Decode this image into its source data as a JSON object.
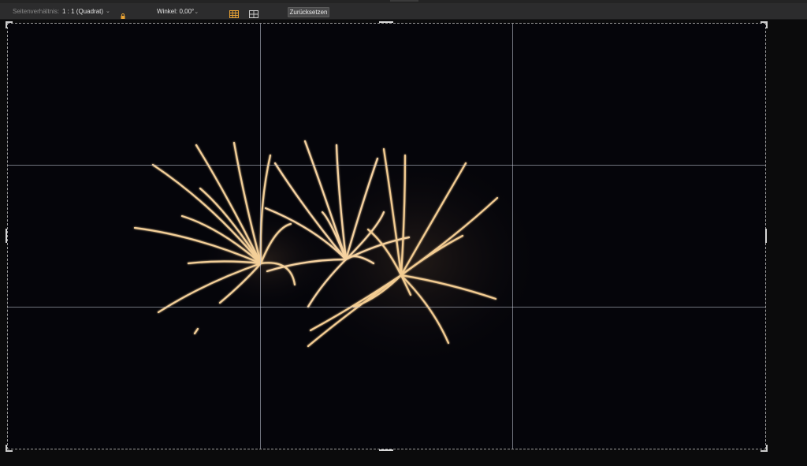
{
  "toolbar": {
    "aspect_label": "Seitenverhältnis:",
    "aspect_value": "1 : 1 (Quadrat)",
    "angle_label": "Winkel:",
    "angle_value": "0,00°",
    "reset_label": "Zurücksetzen",
    "icons": {
      "dropdown": "chevron-down-icon",
      "lock": "lock-icon",
      "grid": "grid-icon",
      "guides": "guides-icon"
    },
    "lock_color": "#e8a234",
    "grid_icon_color": "#e8a234"
  },
  "canvas": {
    "image": "fireworks-photo",
    "background_color": "#05050a",
    "spark_color": "#f2c98a",
    "grid": "rule-of-thirds"
  }
}
